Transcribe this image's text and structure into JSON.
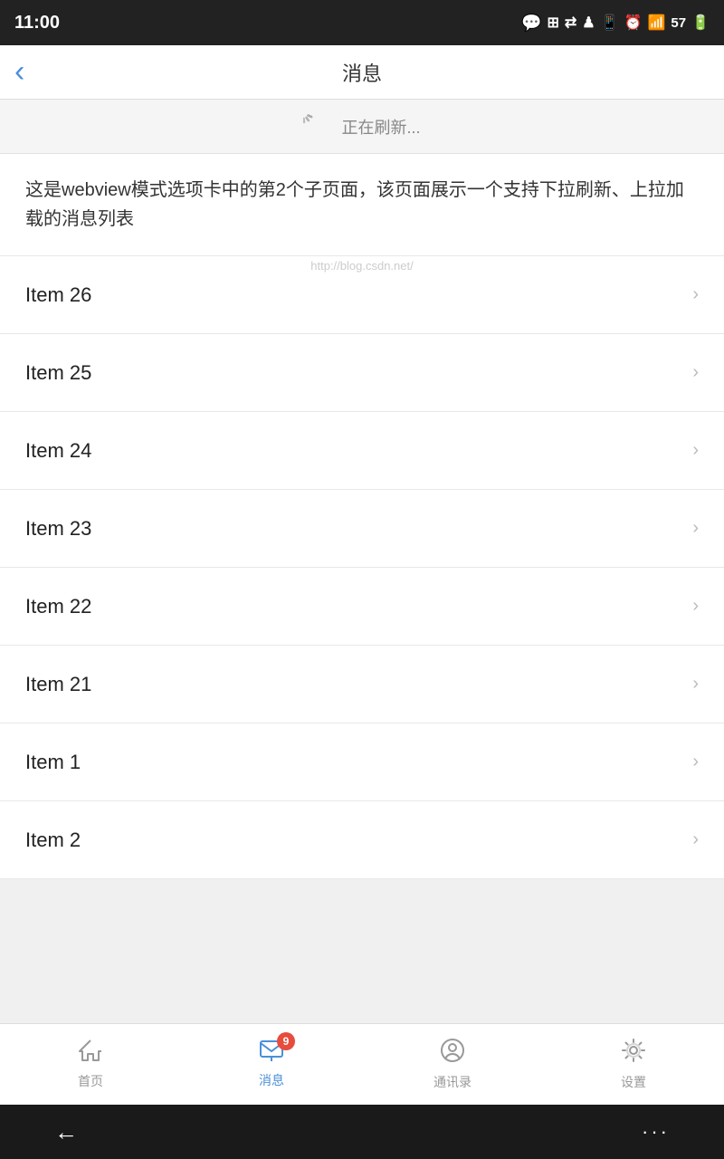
{
  "statusBar": {
    "time": "11:00",
    "battery": "57",
    "icons": "☎ 器 ⇌ ✦ 📱 ⏰ 📶"
  },
  "header": {
    "back_label": "‹",
    "title": "消息"
  },
  "refresh": {
    "text": "正在刷新..."
  },
  "description": {
    "text": "这是webview模式选项卡中的第2个子页面，该页面展示一个支持下拉刷新、上拉加载的消息列表"
  },
  "watermark": {
    "text": "http://blog.csdn.net/"
  },
  "listItems": [
    {
      "label": "Item 26"
    },
    {
      "label": "Item 25"
    },
    {
      "label": "Item 24"
    },
    {
      "label": "Item 23"
    },
    {
      "label": "Item 22"
    },
    {
      "label": "Item 21"
    },
    {
      "label": "Item 1"
    },
    {
      "label": "Item 2"
    }
  ],
  "tabBar": {
    "tabs": [
      {
        "key": "home",
        "label": "首页",
        "active": false,
        "badge": null
      },
      {
        "key": "message",
        "label": "消息",
        "active": true,
        "badge": "9"
      },
      {
        "key": "contacts",
        "label": "通讯录",
        "active": false,
        "badge": null
      },
      {
        "key": "settings",
        "label": "设置",
        "active": false,
        "badge": null
      }
    ]
  },
  "systemNav": {
    "back": "←",
    "dots": "···"
  }
}
